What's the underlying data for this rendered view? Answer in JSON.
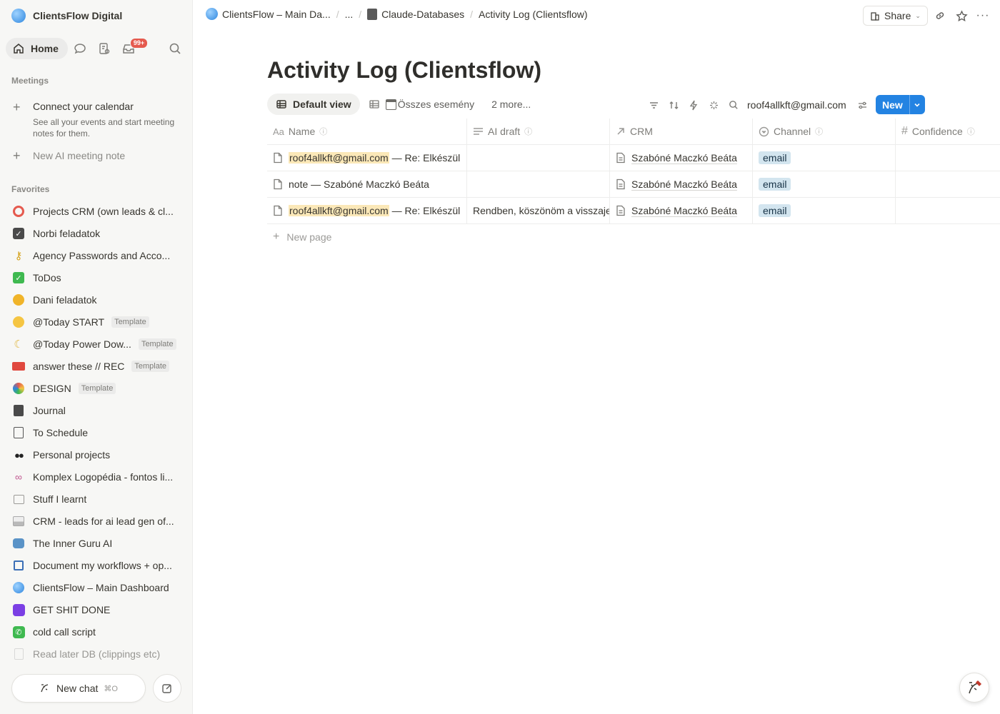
{
  "workspace": {
    "name": "ClientsFlow Digital"
  },
  "nav": {
    "home": "Home",
    "inbox_badge": "99+"
  },
  "meetings": {
    "label": "Meetings",
    "connect_title": "Connect your calendar",
    "connect_desc": "See all your events and start meeting notes for them.",
    "new_note": "New AI meeting note"
  },
  "favorites": {
    "label": "Favorites",
    "items": [
      {
        "label": "Projects CRM (own leads & cl...",
        "icon": "target-icon"
      },
      {
        "label": "Norbi feladatok",
        "icon": "checkbox-icon"
      },
      {
        "label": "Agency Passwords and Acco...",
        "icon": "key-icon"
      },
      {
        "label": "ToDos",
        "icon": "green-check-icon"
      },
      {
        "label": "Dani feladatok",
        "icon": "cat-icon"
      },
      {
        "label": "@Today START",
        "icon": "smile-icon",
        "badge": "Template"
      },
      {
        "label": "@Today Power Dow...",
        "icon": "moon-icon",
        "badge": "Template"
      },
      {
        "label": "answer these // REC",
        "icon": "video-icon",
        "badge": "Template"
      },
      {
        "label": "DESIGN",
        "icon": "palette-icon",
        "badge": "Template"
      },
      {
        "label": "Journal",
        "icon": "notebook-icon"
      },
      {
        "label": "To Schedule",
        "icon": "list-icon"
      },
      {
        "label": "Personal projects",
        "icon": "sunglasses-icon"
      },
      {
        "label": "Komplex Logopédia - fontos li...",
        "icon": "link-icon"
      },
      {
        "label": "Stuff I learnt",
        "icon": "table-icon"
      },
      {
        "label": "CRM - leads for ai lead gen of...",
        "icon": "inbox-tray-icon"
      },
      {
        "label": "The Inner Guru AI",
        "icon": "robot-icon"
      },
      {
        "label": "Document my workflows + op...",
        "icon": "chip-icon"
      },
      {
        "label": "ClientsFlow – Main Dashboard",
        "icon": "globe-icon"
      },
      {
        "label": "GET SHIT DONE",
        "icon": "purple-circle-icon"
      },
      {
        "label": "cold call script",
        "icon": "phone-icon"
      },
      {
        "label": "Read later DB (clippings etc)",
        "icon": "page-icon"
      }
    ]
  },
  "newchat": {
    "label": "New chat",
    "shortcut": "⌘O"
  },
  "breadcrumb": {
    "items": [
      "ClientsFlow – Main Da...",
      "...",
      "Claude-Databases",
      "Activity Log (Clientsflow)"
    ]
  },
  "topbar": {
    "share": "Share"
  },
  "page": {
    "title": "Activity Log (Clientsflow)"
  },
  "views": {
    "default": "Default view",
    "second": "Összes esemény",
    "more": "2 more..."
  },
  "search": {
    "query": "roof4allkft@gmail.com"
  },
  "new_button": "New",
  "table": {
    "columns": [
      {
        "label": "Name",
        "icon": "Aa"
      },
      {
        "label": "AI draft",
        "icon": "text-icon"
      },
      {
        "label": "CRM",
        "icon": "relation-arrow-icon"
      },
      {
        "label": "Channel",
        "icon": "select-icon"
      },
      {
        "label": "Confidence",
        "icon": "#"
      }
    ],
    "rows": [
      {
        "name_hl": "roof4allkft@gmail.com",
        "name_rest": " — Re: Elkészül",
        "ai_draft": "",
        "crm": "Szabóné Maczkó Beáta",
        "channel": "email",
        "confidence": ""
      },
      {
        "name_hl": "",
        "name_rest": "note — Szabóné Maczkó Beáta",
        "ai_draft": "",
        "crm": "Szabóné Maczkó Beáta",
        "channel": "email",
        "confidence": ""
      },
      {
        "name_hl": "roof4allkft@gmail.com",
        "name_rest": " — Re: Elkészül",
        "ai_draft": "Rendben, köszönöm a visszaje",
        "crm": "Szabóné Maczkó Beáta",
        "channel": "email",
        "confidence": ""
      }
    ],
    "new_page": "New page"
  },
  "colors": {
    "accent": "#2383e2",
    "highlight": "#fbe8b8",
    "tag_bg": "#d3e5ef",
    "badge": "#e55a4e"
  }
}
